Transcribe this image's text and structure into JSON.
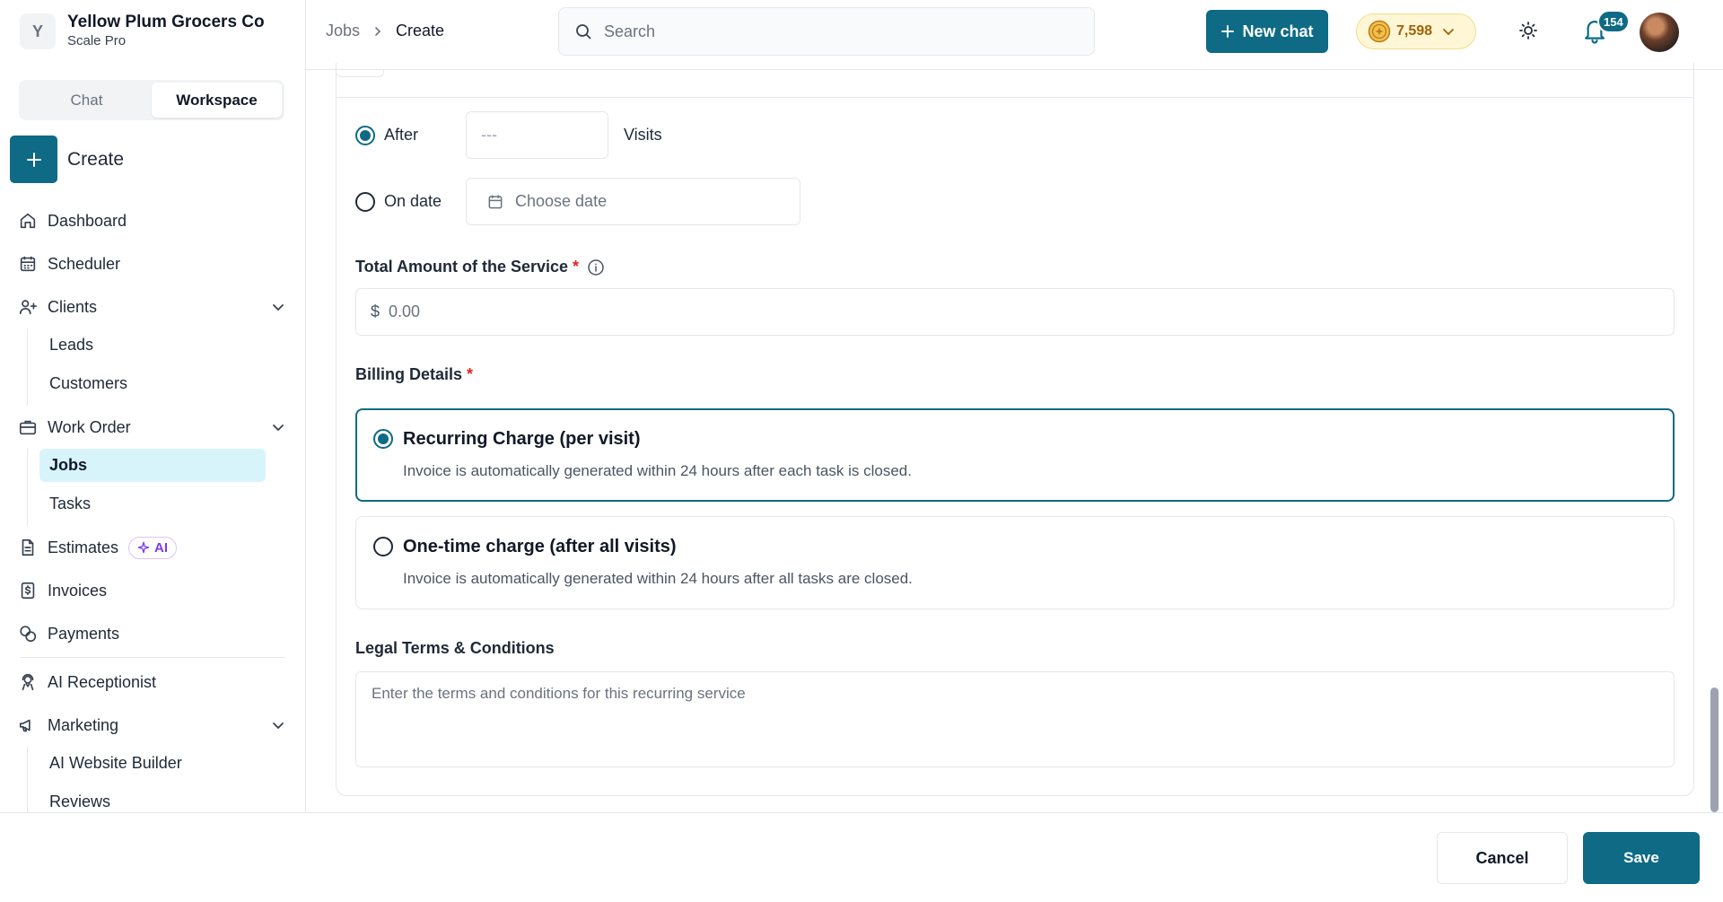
{
  "org": {
    "initial": "Y",
    "name": "Yellow Plum Grocers Co",
    "plan": "Scale Pro"
  },
  "mode_tabs": [
    {
      "label": "Chat",
      "active": false
    },
    {
      "label": "Workspace",
      "active": true
    }
  ],
  "create_label": "Create",
  "nav": {
    "dashboard": "Dashboard",
    "scheduler": "Scheduler",
    "clients": "Clients",
    "clients_sub": [
      "Leads",
      "Customers"
    ],
    "work_order": "Work Order",
    "work_order_sub": [
      "Jobs",
      "Tasks"
    ],
    "estimates": "Estimates",
    "estimates_badge": "AI",
    "invoices": "Invoices",
    "payments": "Payments",
    "ai_receptionist": "AI Receptionist",
    "marketing": "Marketing",
    "marketing_sub": [
      "AI Website Builder",
      "Reviews"
    ],
    "active_item": "Jobs"
  },
  "breadcrumb": [
    "Jobs",
    "Create"
  ],
  "search": {
    "placeholder": "Search"
  },
  "new_chat_label": "New chat",
  "credits": "7,598",
  "notifications_count": "154",
  "form": {
    "end_after": {
      "label": "After",
      "placeholder": "---",
      "unit": "Visits",
      "selected": true
    },
    "end_on_date": {
      "label": "On date",
      "placeholder": "Choose date",
      "selected": false
    },
    "total_amount": {
      "label": "Total Amount of the Service",
      "required_mark": "*",
      "currency": "$",
      "placeholder": "0.00"
    },
    "billing": {
      "label": "Billing Details",
      "required_mark": "*",
      "options": [
        {
          "title": "Recurring Charge (per visit)",
          "description": "Invoice is automatically generated within 24 hours after each task is closed.",
          "selected": true
        },
        {
          "title": "One-time charge (after all visits)",
          "description": "Invoice is automatically generated within 24 hours after all tasks are closed.",
          "selected": false
        }
      ]
    },
    "terms": {
      "label": "Legal Terms & Conditions",
      "placeholder": "Enter the terms and conditions for this recurring service"
    }
  },
  "footer": {
    "cancel_label": "Cancel",
    "save_label": "Save"
  },
  "colors": {
    "accent": "#0e6a85",
    "active_nav_bg": "#d8f4fb",
    "required": "#dc2626",
    "ai_badge": "#7c3aed",
    "credits_bg": "#fef6d5"
  }
}
